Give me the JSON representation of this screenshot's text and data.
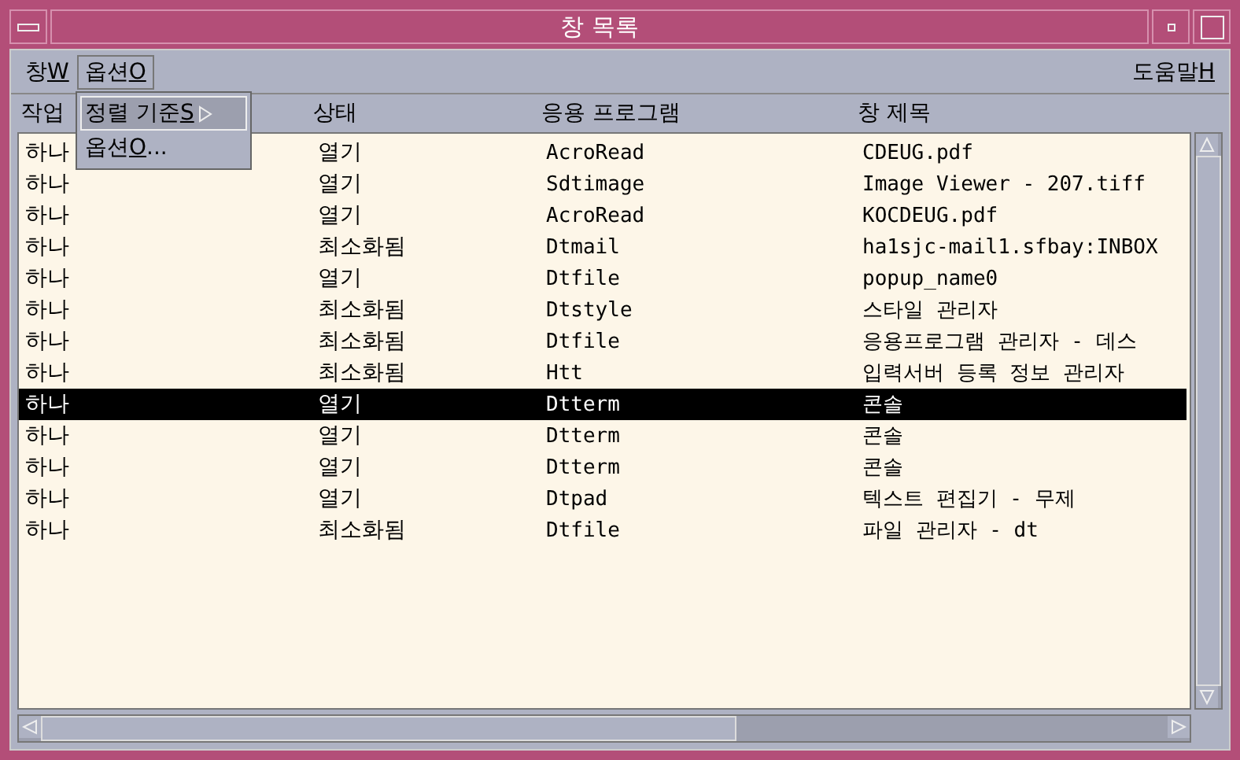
{
  "window": {
    "title": "창 목록"
  },
  "menubar": [
    {
      "label": "창",
      "mnemonic": "W",
      "selected": false
    },
    {
      "label": "옵션",
      "mnemonic": "O",
      "selected": true
    }
  ],
  "help_menu": {
    "label": "도움말",
    "mnemonic": "H"
  },
  "open_menu": [
    {
      "label": "정렬 기준",
      "mnemonic": "S",
      "submenu": true,
      "selected": true
    },
    {
      "label": "옵션",
      "mnemonic": "O",
      "suffix": "...",
      "submenu": false,
      "selected": false
    }
  ],
  "table": {
    "columns": [
      "작업",
      "상태",
      "응용 프로그램",
      "창 제목"
    ],
    "rows": [
      {
        "cells": [
          "하나",
          "열기",
          "AcroRead",
          "CDEUG.pdf"
        ],
        "selected": false
      },
      {
        "cells": [
          "하나",
          "열기",
          "Sdtimage",
          "Image Viewer - 207.tiff"
        ],
        "selected": false
      },
      {
        "cells": [
          "하나",
          "열기",
          "AcroRead",
          "KOCDEUG.pdf"
        ],
        "selected": false
      },
      {
        "cells": [
          "하나",
          "최소화됨",
          "Dtmail",
          "ha1sjc-mail1.sfbay:INBOX"
        ],
        "selected": false
      },
      {
        "cells": [
          "하나",
          "열기",
          "Dtfile",
          "popup_name0"
        ],
        "selected": false
      },
      {
        "cells": [
          "하나",
          "최소화됨",
          "Dtstyle",
          "스타일 관리자"
        ],
        "selected": false
      },
      {
        "cells": [
          "하나",
          "최소화됨",
          "Dtfile",
          "응용프로그램 관리자 - 데스"
        ],
        "selected": false
      },
      {
        "cells": [
          "하나",
          "최소화됨",
          "Htt",
          "입력서버 등록 정보 관리자"
        ],
        "selected": false
      },
      {
        "cells": [
          "하나",
          "열기",
          "Dtterm",
          "콘솔"
        ],
        "selected": true
      },
      {
        "cells": [
          "하나",
          "열기",
          "Dtterm",
          "콘솔"
        ],
        "selected": false
      },
      {
        "cells": [
          "하나",
          "열기",
          "Dtterm",
          "콘솔"
        ],
        "selected": false
      },
      {
        "cells": [
          "하나",
          "열기",
          "Dtpad",
          "텍스트 편집기 - 무제"
        ],
        "selected": false
      },
      {
        "cells": [
          "하나",
          "최소화됨",
          "Dtfile",
          "파일 관리자 - dt"
        ],
        "selected": false
      }
    ]
  }
}
